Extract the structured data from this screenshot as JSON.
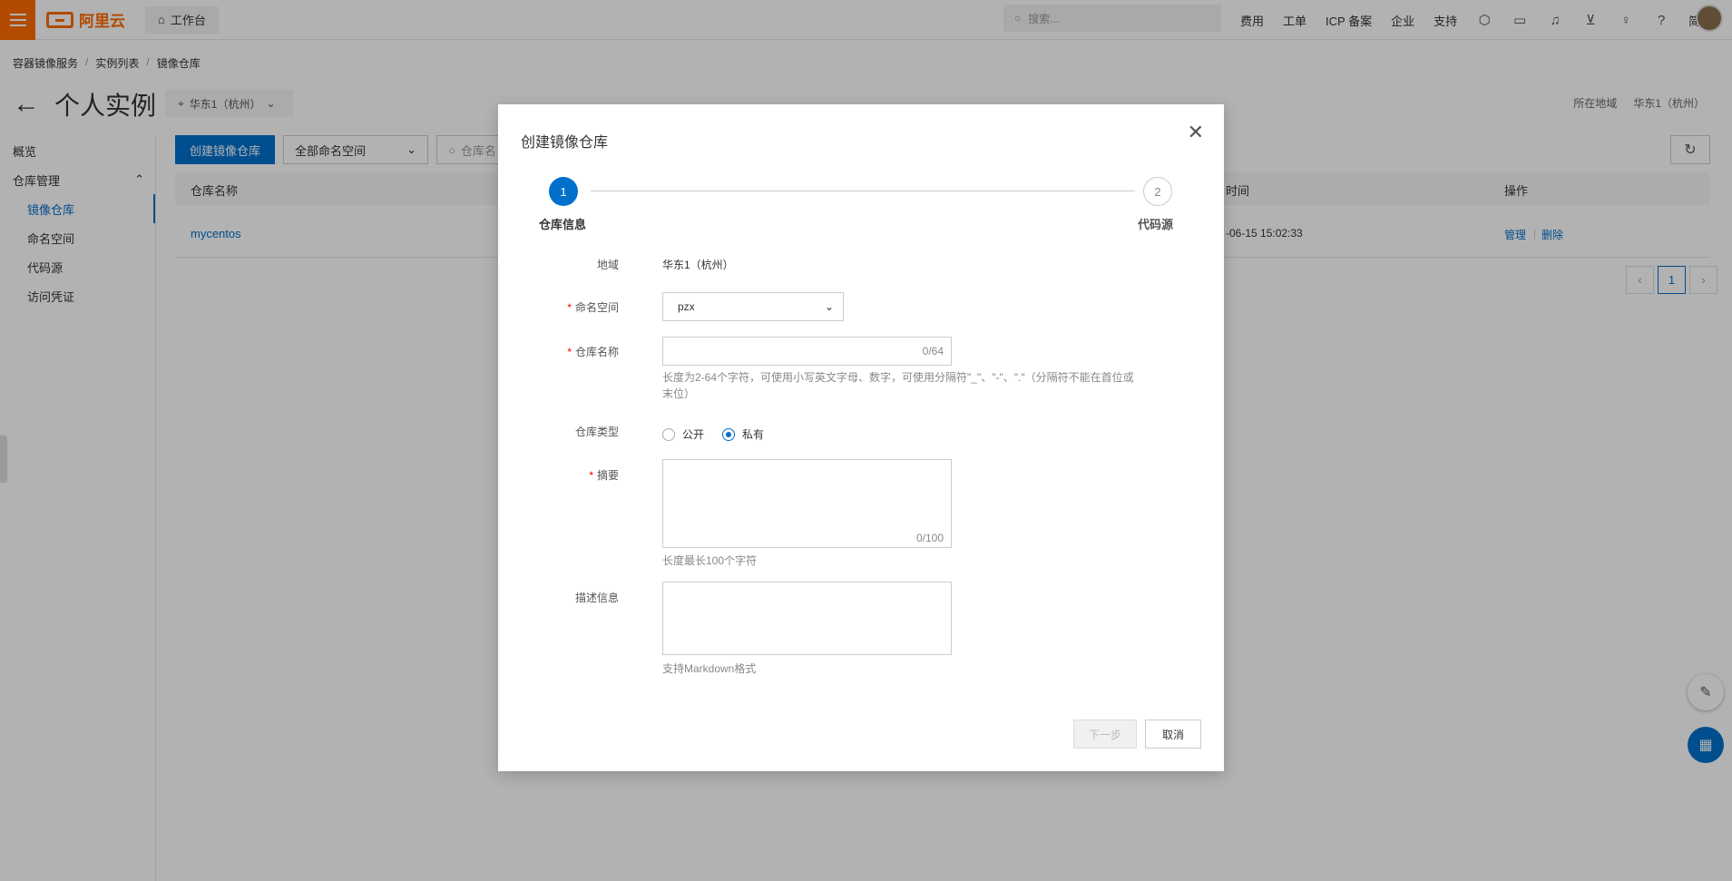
{
  "topbar": {
    "brand": "阿里云",
    "workbench": "工作台",
    "search_placeholder": "搜索...",
    "links": [
      "费用",
      "工单",
      "ICP 备案",
      "企业",
      "支持"
    ],
    "lang": "简体"
  },
  "breadcrumb": [
    "容器镜像服务",
    "实例列表",
    "镜像仓库"
  ],
  "page": {
    "title": "个人实例",
    "region": "华东1（杭州）",
    "region_label": "所在地域",
    "region_value": "华东1（杭州）"
  },
  "sidebar": {
    "overview": "概览",
    "group": "仓库管理",
    "items": [
      "镜像仓库",
      "命名空间",
      "代码源",
      "访问凭证"
    ]
  },
  "toolbar": {
    "create_label": "创建镜像仓库",
    "namespace_select": "全部命名空间",
    "search_placeholder": "仓库名"
  },
  "table": {
    "col_name": "仓库名称",
    "col_time": "时间",
    "col_action": "操作",
    "row": {
      "name": "mycentos",
      "time": "-06-15 15:02:33",
      "manage": "管理",
      "delete": "删除"
    }
  },
  "pager": {
    "current": "1"
  },
  "modal": {
    "title": "创建镜像仓库",
    "steps": [
      {
        "num": "1",
        "label": "仓库信息"
      },
      {
        "num": "2",
        "label": "代码源"
      }
    ],
    "region_label": "地域",
    "region_value": "华东1（杭州）",
    "namespace_label": "命名空间",
    "namespace_value": "pzx",
    "repo_name_label": "仓库名称",
    "repo_name_counter": "0/64",
    "repo_name_help": "长度为2-64个字符，可使用小写英文字母、数字，可使用分隔符\"_\"、\"-\"、\".\"（分隔符不能在首位或末位）",
    "repo_type_label": "仓库类型",
    "repo_type_public": "公开",
    "repo_type_private": "私有",
    "summary_label": "摘要",
    "summary_counter": "0/100",
    "summary_help": "长度最长100个字符",
    "desc_label": "描述信息",
    "desc_help": "支持Markdown格式",
    "next_label": "下一步",
    "cancel_label": "取消"
  }
}
